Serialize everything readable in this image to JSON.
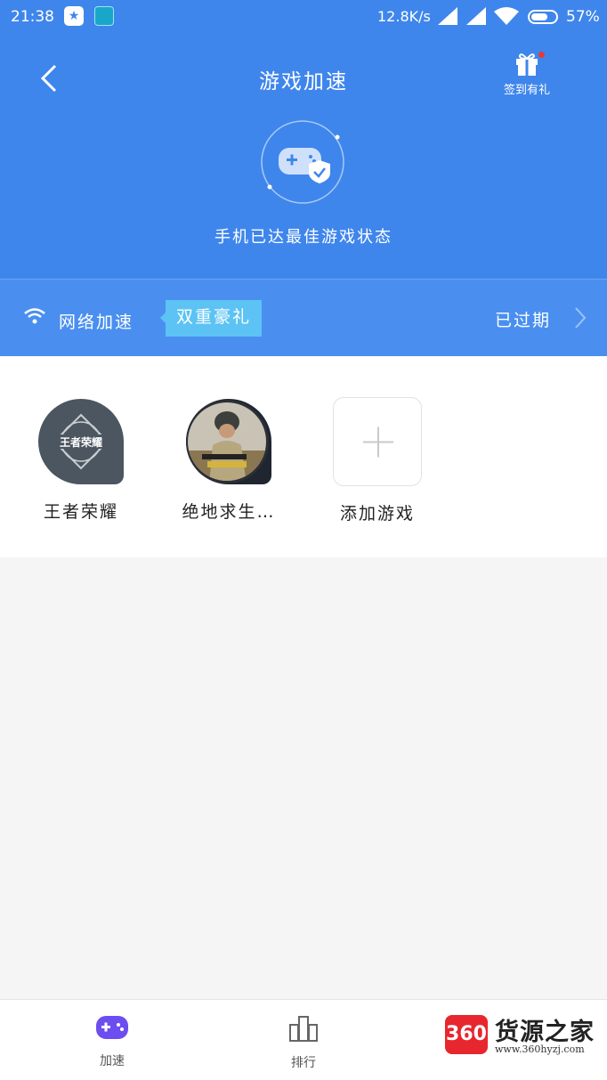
{
  "status_bar": {
    "time": "21:38",
    "network_speed": "12.8K/s",
    "battery": "57%",
    "app_badge": "★"
  },
  "header": {
    "title": "游戏加速",
    "gift_label": "签到有礼",
    "state_text": "手机已达最佳游戏状态"
  },
  "network": {
    "label": "网络加速",
    "promo": "双重豪礼",
    "status": "已过期"
  },
  "games": [
    {
      "name": "王者荣耀",
      "icon": "wangzhe-icon",
      "logo_text": "王者荣耀"
    },
    {
      "name": "绝地求生…",
      "icon": "pubg-icon"
    },
    {
      "name": "添加游戏",
      "icon": "plus-icon"
    }
  ],
  "tabs": [
    {
      "label": "加速",
      "icon": "gamepad-icon",
      "active": true
    },
    {
      "label": "排行",
      "icon": "bar-chart-icon",
      "active": false
    }
  ],
  "watermark": {
    "logo": "360",
    "title": "货源之家",
    "url": "www.360hyzj.com"
  },
  "colors": {
    "primary": "#3f86ec",
    "promo": "#5cc3f4",
    "active_tab": "#6c4ef0",
    "badge_red": "#e63a3a"
  }
}
